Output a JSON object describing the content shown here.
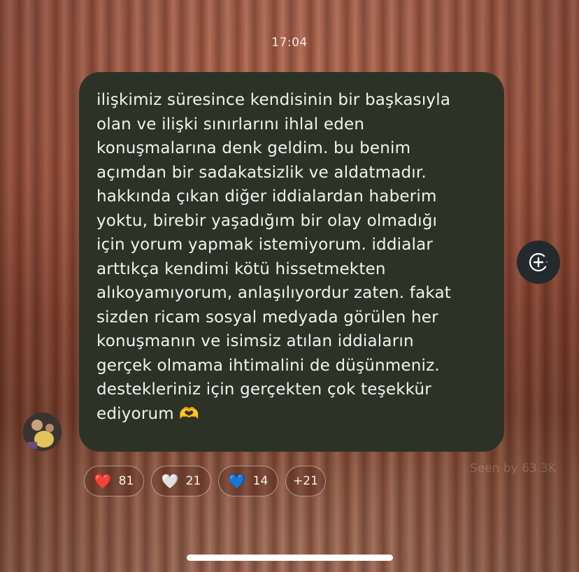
{
  "status": {
    "time": "17:04"
  },
  "message": {
    "text": "ilişkimiz süresince kendisinin bir başkasıyla\nolan ve ilişki sınırlarını ihlal eden\nkonuşmalarına denk geldim. bu benim\naçımdan bir sadakatsizlik ve aldatmadır.\nhakkında çıkan diğer iddialardan haberim\nyoktu, birebir yaşadığım bir olay olmadığı\niçin yorum yapmak istemiyorum. iddialar\narttıkça kendimi kötü hissetmekten\nalıkoyamıyorum, anlaşılıyordur zaten. fakat\nsizden ricam sosyal medyada görülen her\nkonuşmanın ve isimsiz atılan iddiaların\ngerçek olmama ihtimalini de düşünmeniz.\ndestekleriniz için gerçekten çok teşekkür\nediyorum 🫶"
  },
  "seen": "Seen by 63.3K",
  "reactions": [
    {
      "emoji": "❤️",
      "count": "81"
    },
    {
      "emoji": "🤍",
      "count": "21"
    },
    {
      "emoji": "💙",
      "count": "14"
    },
    {
      "label": "+21"
    }
  ],
  "colors": {
    "bubble": "#2c3326",
    "text": "#f1f3ee",
    "add_button": "#232a2e"
  }
}
